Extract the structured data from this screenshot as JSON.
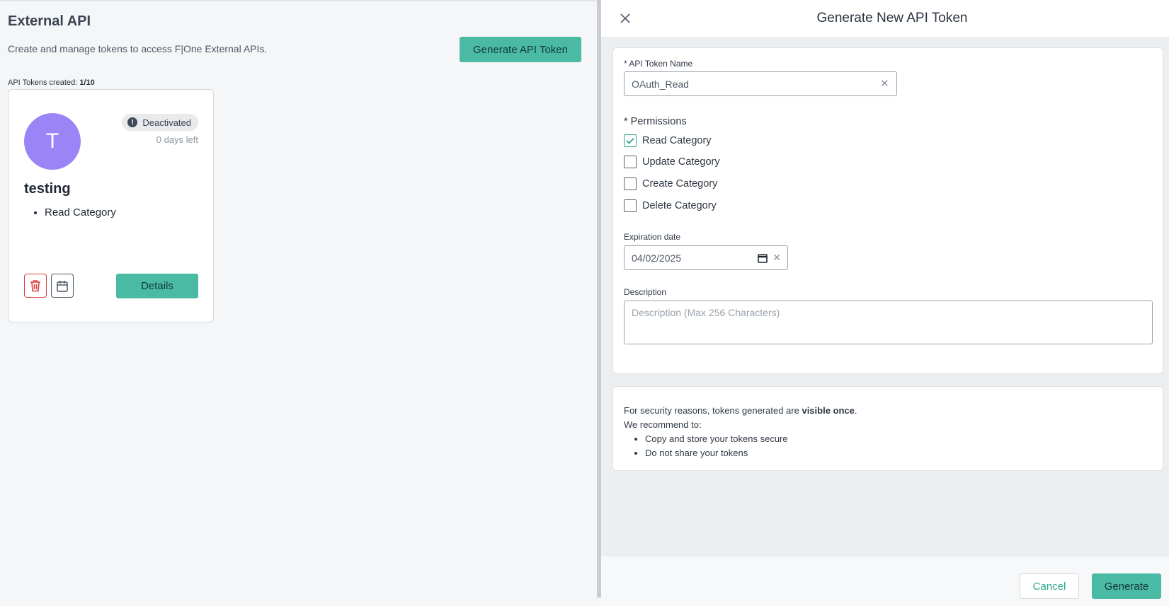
{
  "page": {
    "title": "External API",
    "subtitle": "Create and manage tokens to access F|One External APIs.",
    "generate_button": "Generate API Token",
    "tokens_created_label": "API Tokens created:",
    "tokens_created_value": "1/10"
  },
  "token_card": {
    "avatar_letter": "T",
    "status": "Deactivated",
    "status_icon": "alert-icon",
    "days_left": "0 days left",
    "name": "testing",
    "permissions": [
      "Read Category"
    ],
    "delete_icon": "trash-icon",
    "calendar_icon": "calendar-icon",
    "details_button": "Details"
  },
  "drawer": {
    "title": "Generate New API Token",
    "close_icon": "close-icon",
    "name_label": "API Token Name",
    "name_value": "OAuth_Read",
    "permissions_label": "Permissions",
    "permissions": [
      {
        "label": "Read Category",
        "checked": true
      },
      {
        "label": "Update Category",
        "checked": false
      },
      {
        "label": "Create Category",
        "checked": false
      },
      {
        "label": "Delete Category",
        "checked": false
      }
    ],
    "expiration_label": "Expiration date",
    "expiration_value": "04/02/2025",
    "description_label": "Description",
    "description_placeholder": "Description (Max 256 Characters)",
    "info_prefix": "For security reasons, tokens generated are ",
    "info_bold": "visible once",
    "info_suffix": ".",
    "recommend_label": "We recommend to:",
    "recommendations": [
      "Copy and store your tokens secure",
      "Do not share your tokens"
    ],
    "cancel_button": "Cancel",
    "generate_button": "Generate"
  },
  "colors": {
    "accent": "#4bbaa5",
    "avatar": "#9b84f5",
    "danger": "#e03b3b"
  }
}
